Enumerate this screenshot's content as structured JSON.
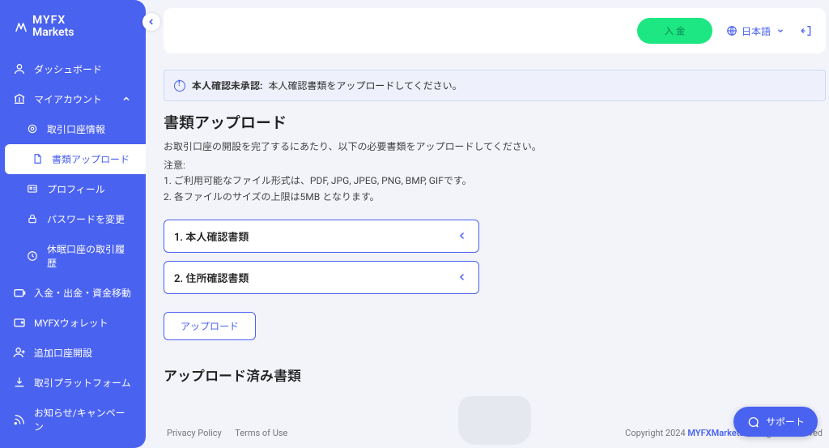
{
  "brand": {
    "line1": "MYFX",
    "line2": "Markets"
  },
  "sidebar": {
    "items": [
      {
        "label": "ダッシュボード"
      },
      {
        "label": "マイアカウント"
      },
      {
        "label": "取引口座情報"
      },
      {
        "label": "書類アップロード"
      },
      {
        "label": "プロフィール"
      },
      {
        "label": "パスワードを変更"
      },
      {
        "label": "休眠口座の取引履歴"
      },
      {
        "label": "入金・出金・資金移動"
      },
      {
        "label": "MYFXウォレット"
      },
      {
        "label": "追加口座開設"
      },
      {
        "label": "取引プラットフォーム"
      },
      {
        "label": "お知らせ/キャンペーン"
      }
    ]
  },
  "topbar": {
    "deposit": "入 金",
    "language": "日本語"
  },
  "alert": {
    "strong": "本人確認未承認:",
    "text": "本人確認書類をアップロードしてください。"
  },
  "page": {
    "title": "書類アップロード",
    "desc": "お取引口座の開設を完了するにあたり、以下の必要書類をアップロードしてください。",
    "notes_label": "注意:",
    "note1": "1. ご利用可能なファイル形式は、PDF, JPG, JPEG, PNG, BMP, GIFです。",
    "note2": "2. 各ファイルのサイズの上限は5MB となります。"
  },
  "accordion": {
    "item1": "1. 本人確認書類",
    "item2": "2. 住所確認書類"
  },
  "buttons": {
    "upload": "アップロード"
  },
  "section": {
    "uploaded_title": "アップロード済み書類"
  },
  "footer": {
    "link1": "Privacy Policy",
    "link2": "Terms of Use",
    "copy_prefix": "Copyright 2024 ",
    "copy_brand": "MYFXMarkets",
    "copy_suffix": " All Rights Reserved"
  },
  "support": {
    "label": "サポート"
  }
}
